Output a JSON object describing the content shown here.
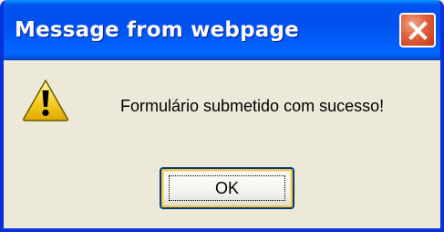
{
  "window": {
    "title": "Message from webpage"
  },
  "dialog": {
    "icon": "warning-icon",
    "message": "Formulário submetido com sucesso!",
    "ok_label": "OK"
  },
  "colors": {
    "titlebar": "#0058ee",
    "close_button": "#e0603b",
    "dialog_background": "#ece9d8",
    "warning_yellow": "#f7d22b"
  }
}
